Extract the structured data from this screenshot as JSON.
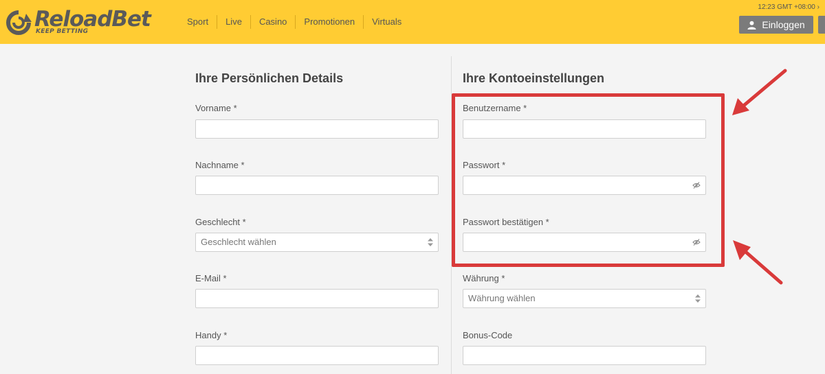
{
  "header": {
    "brand": "ReloadBet",
    "tagline": "KEEP BETTING",
    "clock": "12:23 GMT +08:00",
    "nav": [
      "Sport",
      "Live",
      "Casino",
      "Promotionen",
      "Virtuals"
    ],
    "login_label": "Einloggen",
    "colors": {
      "bar": "#ffcc33",
      "button": "#7b7b7b"
    }
  },
  "personal": {
    "title": "Ihre Persönlichen Details",
    "first_name_label": "Vorname *",
    "last_name_label": "Nachname *",
    "gender_label": "Geschlecht *",
    "gender_placeholder": "Geschlecht wählen",
    "email_label": "E-Mail *",
    "phone_label": "Handy *"
  },
  "account": {
    "title": "Ihre Kontoeinstellungen",
    "username_label": "Benutzername *",
    "password_label": "Passwort *",
    "password_confirm_label": "Passwort bestätigen *",
    "currency_label": "Währung *",
    "currency_placeholder": "Währung wählen",
    "bonus_label": "Bonus-Code"
  },
  "annotation": {
    "color": "#d93a3a"
  }
}
